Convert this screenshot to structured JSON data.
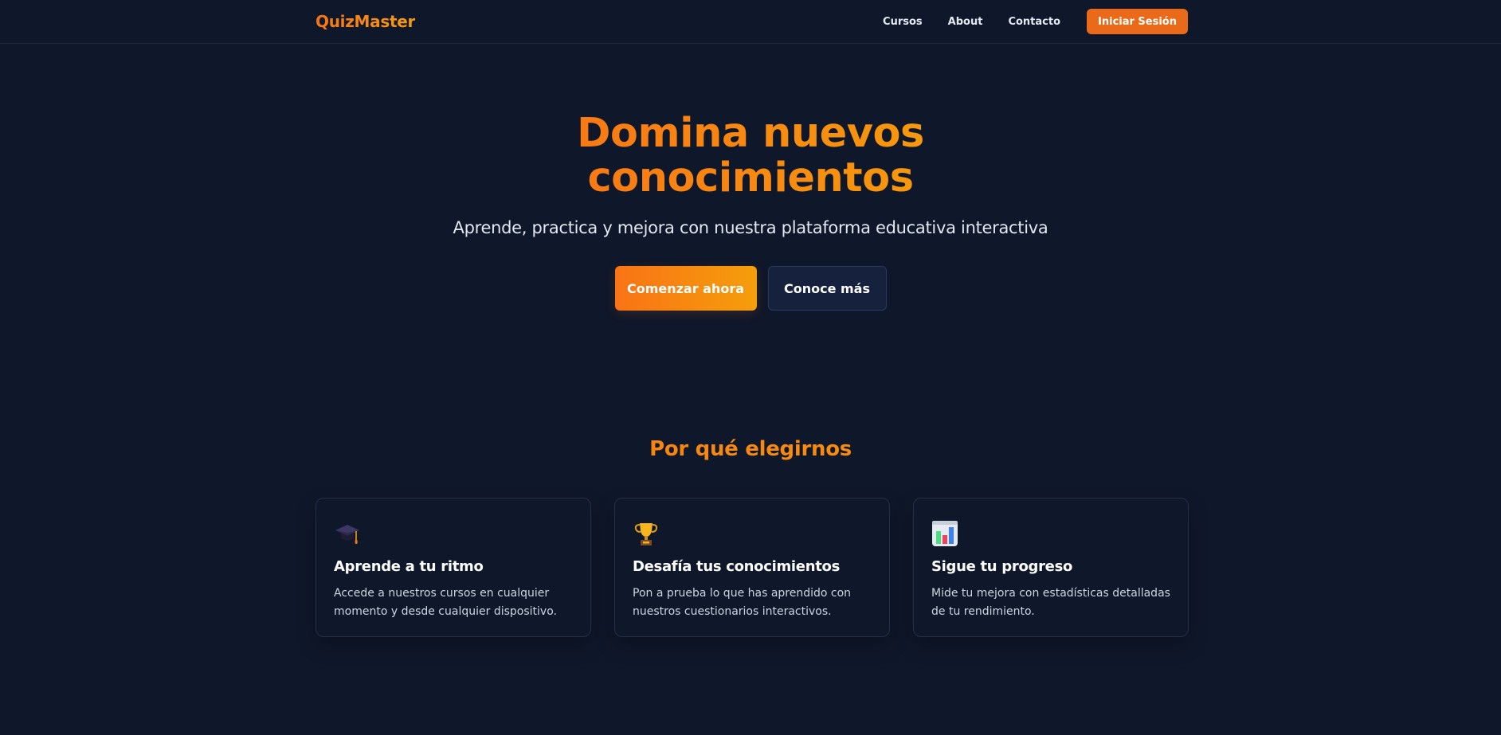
{
  "nav": {
    "logo": "QuizMaster",
    "links": [
      "Cursos",
      "About",
      "Contacto"
    ],
    "login_label": "Iniciar Sesión"
  },
  "hero": {
    "title": "Domina nuevos conocimientos",
    "subtitle": "Aprende, practica y mejora con nuestra plataforma educativa interactiva",
    "primary_label": "Comenzar ahora",
    "secondary_label": "Conoce más"
  },
  "features": {
    "title": "Por qué elegirnos",
    "cards": [
      {
        "icon": "graduation-cap-icon",
        "title": "Aprende a tu ritmo",
        "text": "Accede a nuestros cursos en cualquier momento y desde cualquier dispositivo."
      },
      {
        "icon": "trophy-icon",
        "title": "Desafía tus conocimientos",
        "text": "Pon a prueba lo que has aprendido con nuestros cuestionarios interactivos."
      },
      {
        "icon": "bar-chart-icon",
        "title": "Sigue tu progreso",
        "text": "Mide tu mejora con estadísticas detalladas de tu rendimiento."
      }
    ]
  },
  "colors": {
    "background": "#0f172a",
    "accent_start": "#f97316",
    "accent_end": "#f59e0b"
  }
}
